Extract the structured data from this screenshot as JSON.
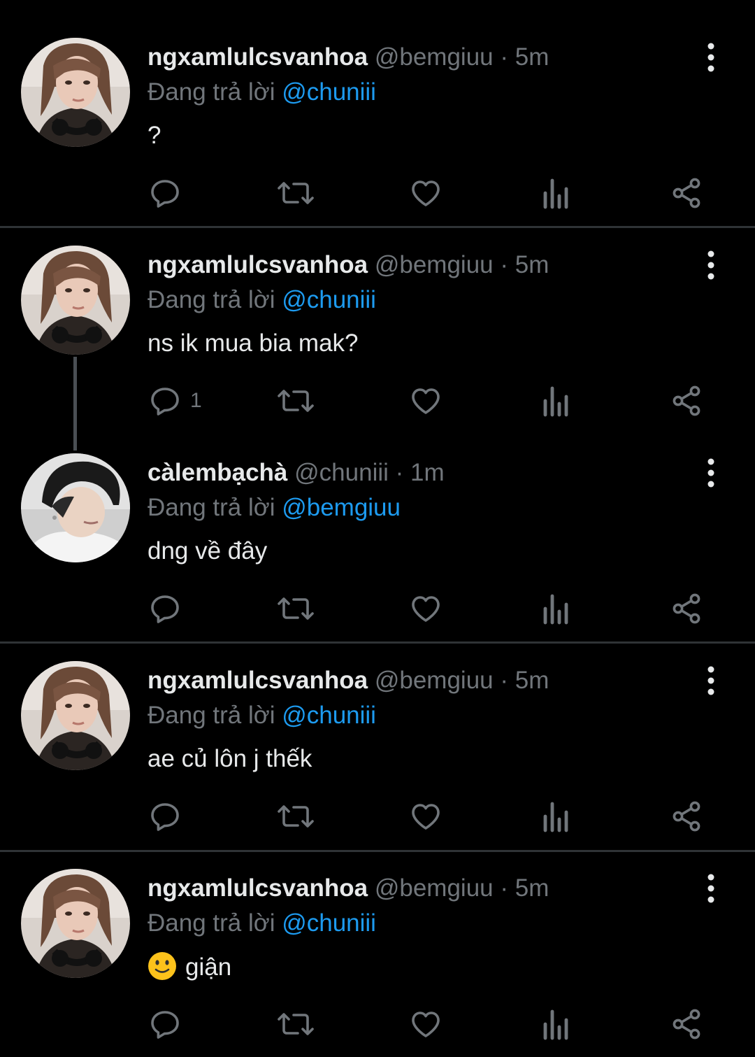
{
  "tweets": [
    {
      "name": "ngxamlulcsvanhoa",
      "handle": "@bemgiuu",
      "sep": "·",
      "time": "5m",
      "reply_prefix": "Đang trả lời",
      "reply_to": "@chuniii",
      "text": "?",
      "reply_count": "",
      "avatar": "long-hair-headphones"
    },
    {
      "name": "ngxamlulcsvanhoa",
      "handle": "@bemgiuu",
      "sep": "·",
      "time": "5m",
      "reply_prefix": "Đang trả lời",
      "reply_to": "@chuniii",
      "text": "ns ik mua bia mak?",
      "reply_count": "1",
      "avatar": "long-hair-headphones"
    },
    {
      "name": "càlembạchà",
      "handle": "@chuniii",
      "sep": "·",
      "time": "1m",
      "reply_prefix": "Đang trả lời",
      "reply_to": "@bemgiuu",
      "text": "dng về đây",
      "reply_count": "",
      "avatar": "black-beanie"
    },
    {
      "name": "ngxamlulcsvanhoa",
      "handle": "@bemgiuu",
      "sep": "·",
      "time": "5m",
      "reply_prefix": "Đang trả lời",
      "reply_to": "@chuniii",
      "text": "ae củ lôn j thếk",
      "reply_count": "",
      "avatar": "long-hair-headphones"
    },
    {
      "name": "ngxamlulcsvanhoa",
      "handle": "@bemgiuu",
      "sep": "·",
      "time": "5m",
      "reply_prefix": "Đang trả lời",
      "reply_to": "@chuniii",
      "text": "giận",
      "text_emoji": "slightly-smiling-face",
      "reply_count": "",
      "avatar": "long-hair-headphones"
    }
  ],
  "action_icons": [
    "reply-icon",
    "retweet-icon",
    "like-icon",
    "views-icon",
    "share-icon"
  ],
  "colors": {
    "background": "#000000",
    "text": "#e7e9ea",
    "muted": "#71767b",
    "mention": "#1d9bf0",
    "divider": "#2f3336"
  }
}
